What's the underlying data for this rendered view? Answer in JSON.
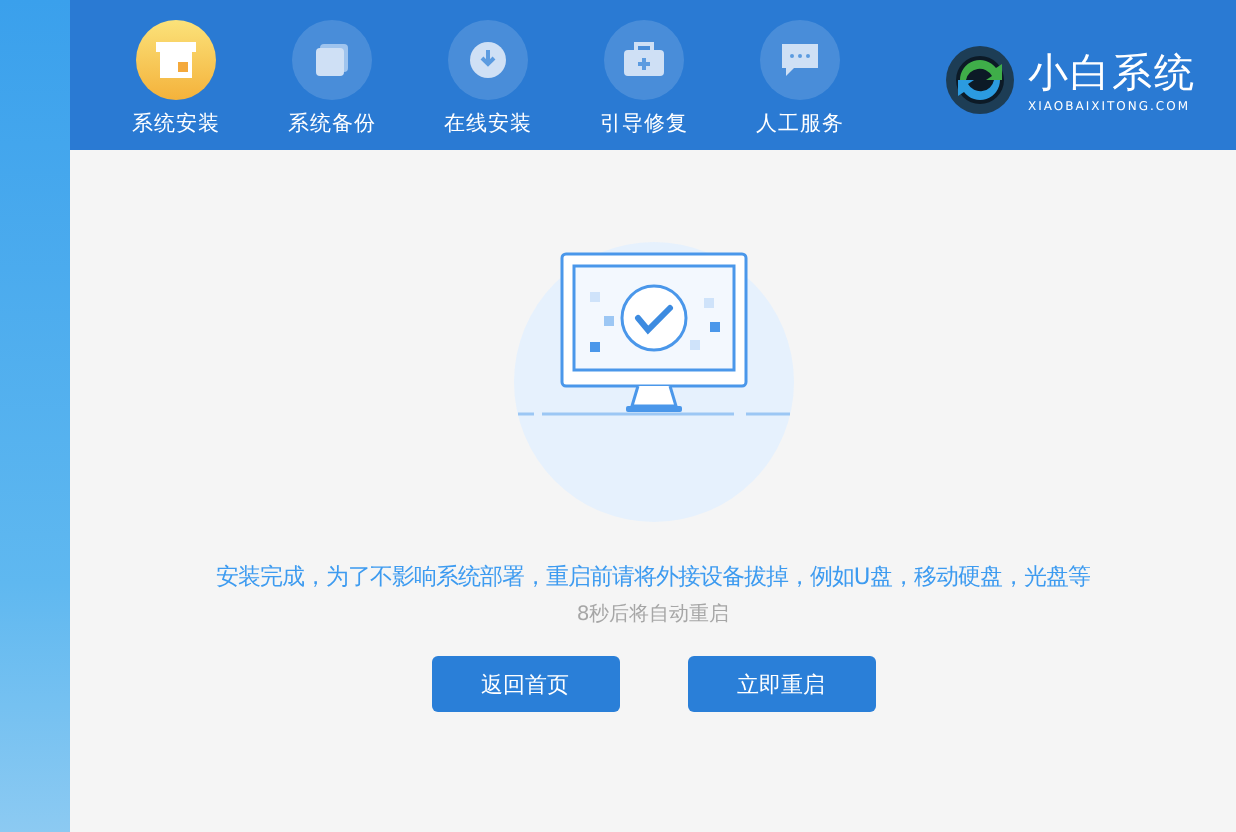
{
  "nav": [
    {
      "label": "系统安装",
      "selected": true,
      "kind": "install"
    },
    {
      "label": "系统备份",
      "selected": false,
      "kind": "backup"
    },
    {
      "label": "在线安装",
      "selected": false,
      "kind": "download"
    },
    {
      "label": "引导修复",
      "selected": false,
      "kind": "repair"
    },
    {
      "label": "人工服务",
      "selected": false,
      "kind": "chat"
    }
  ],
  "brand": {
    "name": "小白系统",
    "url": "XIAOBAIXITONG.COM"
  },
  "message": "安装完成，为了不影响系统部署，重启前请将外接设备拔掉，例如U盘，移动硬盘，光盘等",
  "countdown": "8秒后将自动重启",
  "buttons": [
    "返回首页",
    "立即重启"
  ]
}
